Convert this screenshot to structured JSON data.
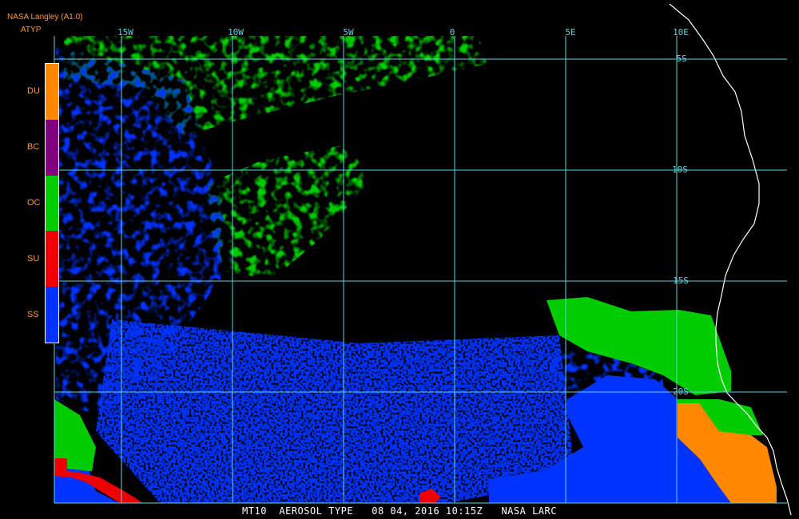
{
  "header": {
    "source": "NASA Langley (A1.0)",
    "product": "ATYP"
  },
  "footer": {
    "caption": "MT10  AEROSOL TYPE   08 04, 2016 10:15Z   NASA LARC"
  },
  "grid": {
    "longitude_labels": [
      "15W",
      "10W",
      "5W",
      "0",
      "5E",
      "10E"
    ],
    "latitude_labels": [
      "5S",
      "10S",
      "15S",
      "20S"
    ],
    "line_color": "#5fd3e0"
  },
  "legend": {
    "classes": [
      {
        "code": "DU",
        "color": "#ff8800"
      },
      {
        "code": "BC",
        "color": "#800080"
      },
      {
        "code": "OC",
        "color": "#00cc00"
      },
      {
        "code": "SU",
        "color": "#ee0000"
      },
      {
        "code": "SS",
        "color": "#0033ff"
      }
    ]
  },
  "colors": {
    "background": "#000000",
    "coastline": "#ffffff",
    "label": "#ff9933"
  }
}
